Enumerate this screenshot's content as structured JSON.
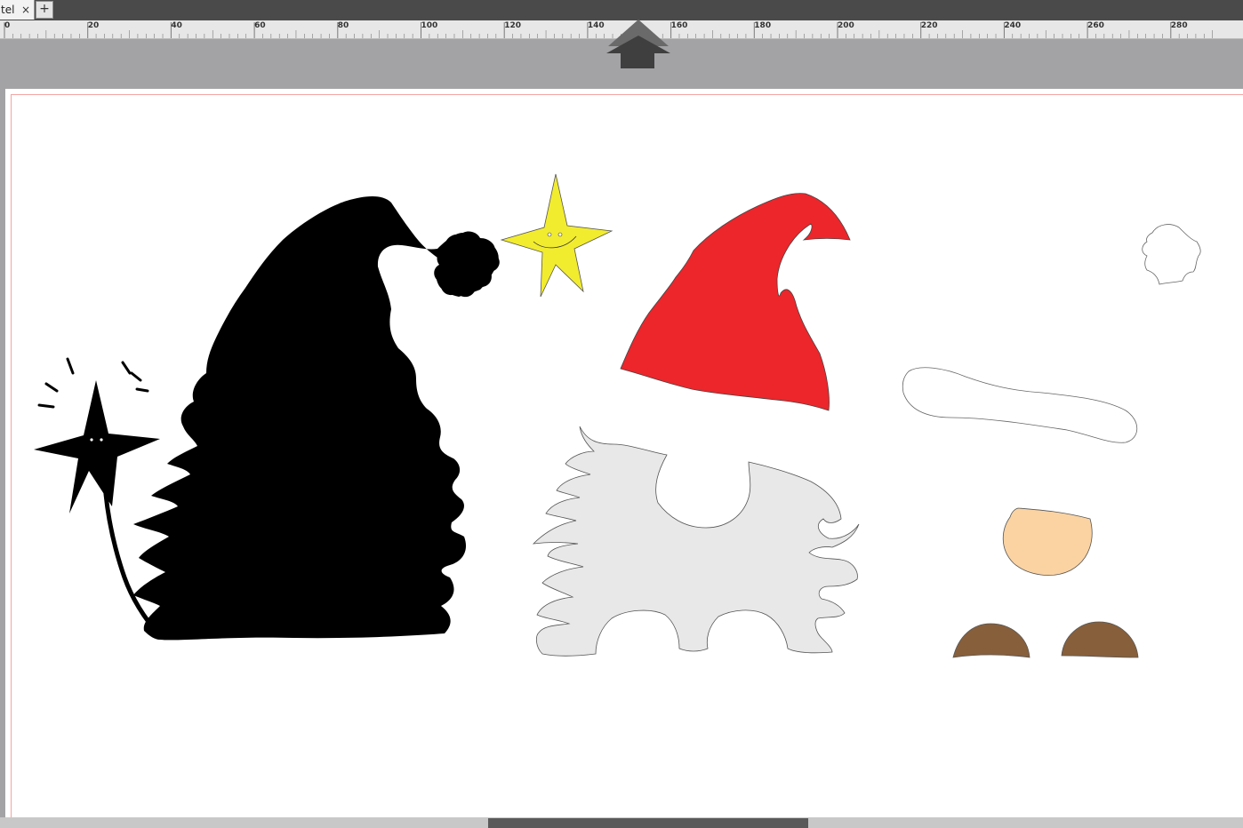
{
  "tabs": [
    {
      "label": "tel",
      "close_glyph": "×"
    }
  ],
  "tab_add_glyph": "+",
  "ruler": {
    "labels": [
      "0",
      "20",
      "40",
      "60",
      "80",
      "100",
      "120",
      "140",
      "160",
      "180",
      "200",
      "220",
      "240",
      "260",
      "280"
    ]
  },
  "canvas": {
    "shapes": [
      {
        "name": "gnome-silhouette",
        "fill": "#000000"
      },
      {
        "name": "star-face",
        "fill": "#f2ec2f"
      },
      {
        "name": "gnome-hat",
        "fill": "#ec262b"
      },
      {
        "name": "beard",
        "fill": "#e8e8e8"
      },
      {
        "name": "pompom-outline",
        "fill": "#ffffff"
      },
      {
        "name": "hat-brim-outline",
        "fill": "#ffffff"
      },
      {
        "name": "nose",
        "fill": "#fbd3a3"
      },
      {
        "name": "left-boot",
        "fill": "#875f3b"
      },
      {
        "name": "right-boot",
        "fill": "#875f3b"
      }
    ]
  },
  "icons": {
    "move-up": "arrow-up-icon"
  }
}
